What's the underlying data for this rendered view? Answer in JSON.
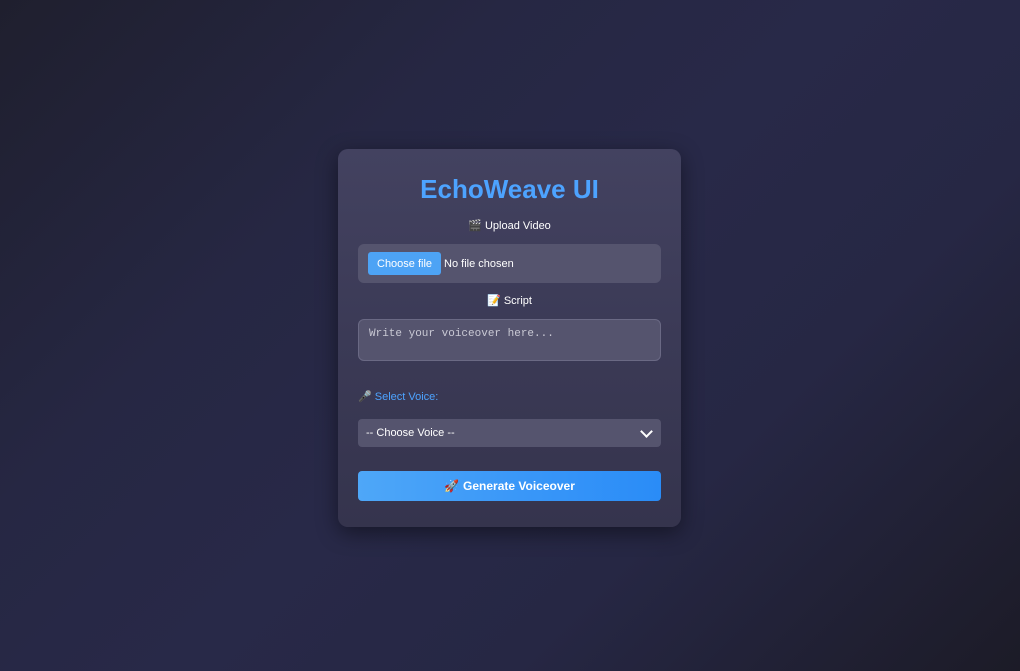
{
  "app": {
    "title": "EchoWeave UI"
  },
  "upload": {
    "icon": "clapper-board-icon",
    "icon_glyph": "🎬",
    "label": "Upload Video",
    "button_label": "Choose file",
    "status": "No file chosen"
  },
  "script": {
    "icon": "memo-icon",
    "icon_glyph": "📝",
    "label": "Script",
    "placeholder": "Write your voiceover here...",
    "value": ""
  },
  "voice": {
    "icon": "microphone-icon",
    "icon_glyph": "🎤",
    "label": "Select Voice:",
    "selected": "-- Choose Voice --"
  },
  "generate": {
    "icon": "rocket-icon",
    "icon_glyph": "🚀",
    "label": "Generate Voiceover"
  },
  "colors": {
    "accent": "#4da3ff",
    "card_bg": "#3b3a56",
    "input_bg": "#55546e",
    "button_start": "#4ea7f8",
    "button_end": "#2a8cf7"
  }
}
